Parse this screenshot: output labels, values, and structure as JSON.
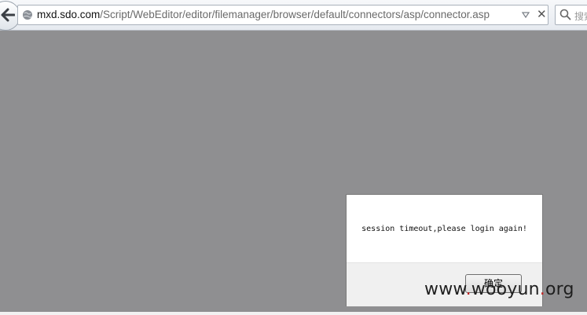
{
  "browser": {
    "url_host": "mxd.sdo.com",
    "url_path": "/Script/WebEditor/editor/filemanager/browser/default/connectors/asp/connector.asp",
    "search_placeholder": "搜索",
    "icons": {
      "back": "back-arrow-icon",
      "site": "globe-icon",
      "history": "dropdown-triangle-icon",
      "stop": "close-icon",
      "search": "search-icon"
    }
  },
  "dialog": {
    "message": "session timeout,please login again!",
    "ok_label": "确定"
  },
  "watermark": {
    "part1": "www",
    "dot1": ".",
    "part2": "wooyun",
    "dot2": ".",
    "part3": "org"
  },
  "colors": {
    "page_background": "#8f8f91",
    "dialog_background": "#ffffff",
    "dialog_footer": "#f0f0f0",
    "watermark_dot": "#c12323"
  }
}
